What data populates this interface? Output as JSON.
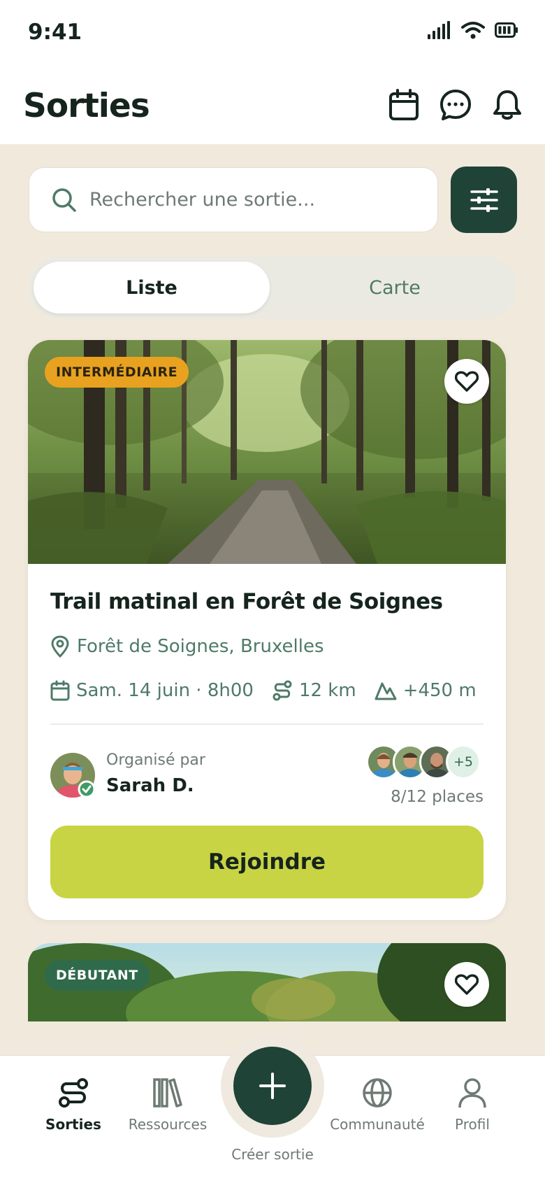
{
  "status": {
    "time": "9:41"
  },
  "header": {
    "title": "Sorties",
    "icons": [
      "calendar-icon",
      "chat-icon",
      "bell-icon"
    ]
  },
  "search": {
    "placeholder": "Rechercher une sortie..."
  },
  "view_toggle": {
    "list": "Liste",
    "map": "Carte",
    "selected": "Liste"
  },
  "cards": [
    {
      "level": "INTERMÉDIAIRE",
      "title": "Trail matinal en Forêt de Soignes",
      "location": "Forêt de Soignes, Bruxelles",
      "date": "Sam. 14 juin · 8h00",
      "distance": "12 km",
      "elevation": "+450 m",
      "organizer_label": "Organisé par",
      "organizer": "Sarah D.",
      "more_participants": "+5",
      "places": "8/12 places",
      "cta": "Rejoindre"
    },
    {
      "level": "DÉBUTANT"
    }
  ],
  "tabbar": {
    "sorties": "Sorties",
    "ressources": "Ressources",
    "create": "Créer sortie",
    "communaute": "Communauté",
    "profil": "Profil"
  },
  "colors": {
    "primary": "#1F4437",
    "accent": "#C8D443",
    "background": "#F0E9DC",
    "intermediate": "#E8A21F",
    "beginner": "#2F6A4B"
  }
}
